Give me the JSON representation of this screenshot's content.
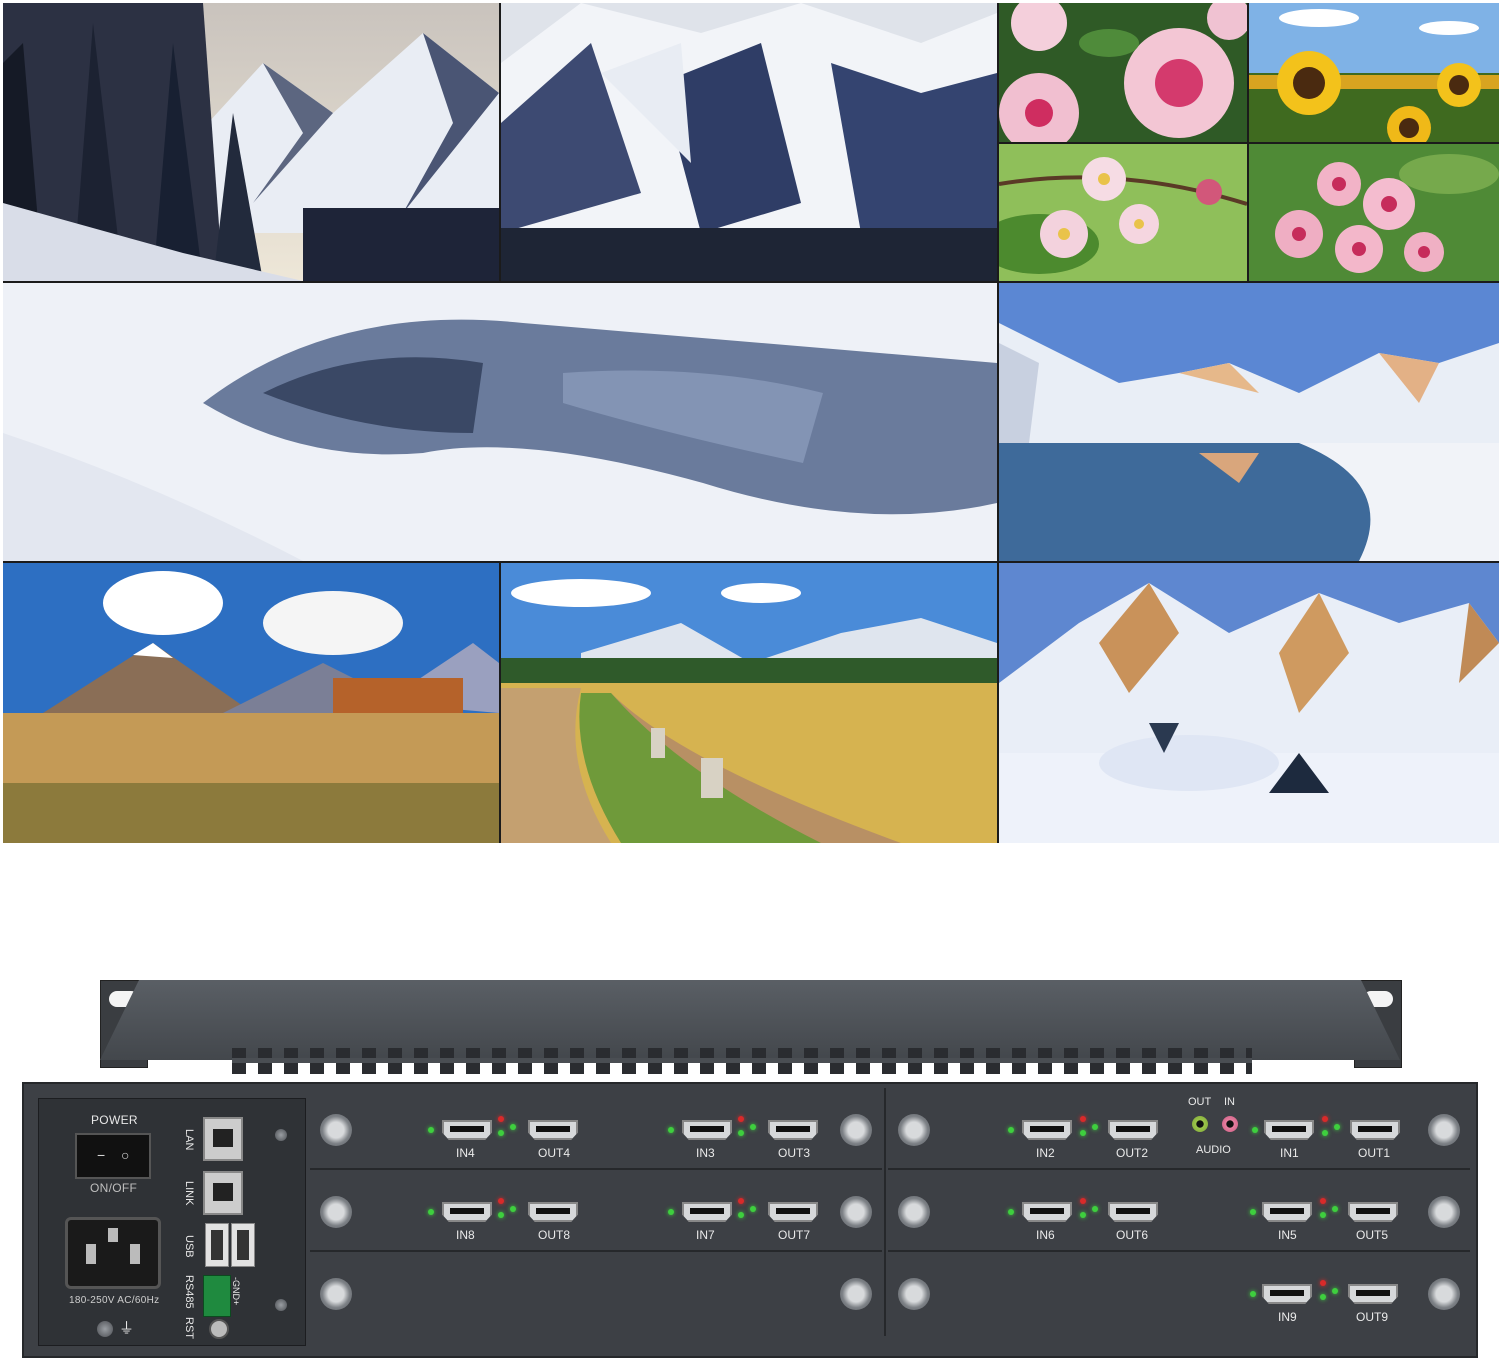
{
  "video_wall": {
    "tiles": [
      {
        "name": "snowy-forest-mountain-tile",
        "scene": "mountain"
      },
      {
        "name": "snowy-peaks-tile",
        "scene": "mountain"
      },
      {
        "name": "pink-flower-tile",
        "scene": "flowers"
      },
      {
        "name": "sunflower-field-tile",
        "scene": "sunflowers"
      },
      {
        "name": "blossom-branch-tile",
        "scene": "blossom"
      },
      {
        "name": "pink-flower-cluster-tile",
        "scene": "flowers"
      },
      {
        "name": "frozen-lake-tile",
        "scene": "snowlake"
      },
      {
        "name": "mountain-lake-reflection-tile",
        "scene": "lake"
      },
      {
        "name": "autumn-meadow-tile",
        "scene": "meadow"
      },
      {
        "name": "country-road-tile",
        "scene": "road"
      },
      {
        "name": "alpine-snowfield-tile",
        "scene": "alpine"
      }
    ]
  },
  "device": {
    "power_label": "POWER",
    "switch_on_symbol": "−",
    "switch_off_symbol": "○",
    "on_off_label": "ON/OFF",
    "voltage_label": "180-250V AC/60Hz",
    "lan_label": "LAN",
    "link_label": "LINK",
    "usb_label": "USB",
    "rs485_label": "RS485",
    "rst_label": "RST",
    "gnd_label": "-GND+",
    "audio": {
      "out_label": "OUT",
      "in_label": "IN",
      "label": "AUDIO"
    },
    "ports": {
      "in1": "IN1",
      "out1": "OUT1",
      "in2": "IN2",
      "out2": "OUT2",
      "in3": "IN3",
      "out3": "OUT3",
      "in4": "IN4",
      "out4": "OUT4",
      "in5": "IN5",
      "out5": "OUT5",
      "in6": "IN6",
      "out6": "OUT6",
      "in7": "IN7",
      "out7": "OUT7",
      "in8": "IN8",
      "out8": "OUT8",
      "in9": "IN9",
      "out9": "OUT9"
    },
    "colors": {
      "chassis": "#3d4045",
      "led_green": "#3ecf3e",
      "led_red": "#d82a2a",
      "terminal": "#1f8a3f"
    }
  }
}
